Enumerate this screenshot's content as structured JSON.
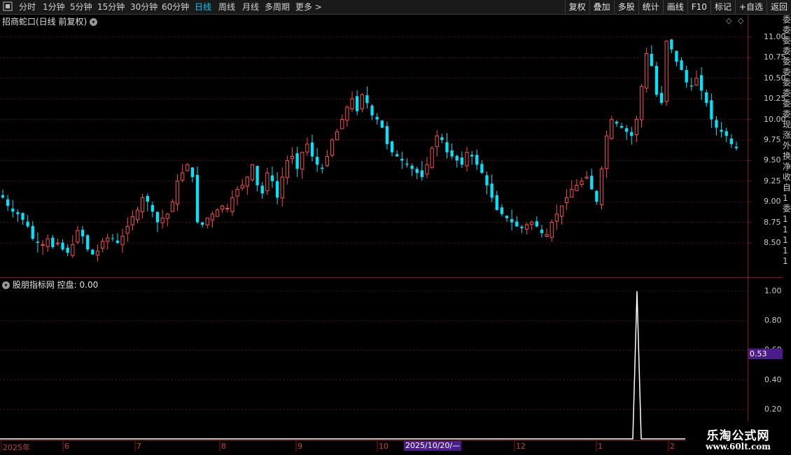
{
  "toolbar": {
    "periods": [
      "分时",
      "1分钟",
      "5分钟",
      "15分钟",
      "30分钟",
      "60分钟",
      "日线",
      "周线",
      "月线",
      "多周期",
      "更多 >"
    ],
    "active_period": "日线",
    "right_buttons": [
      "复权",
      "叠加",
      "多股",
      "统计",
      "画线",
      "F10",
      "标记",
      "+自选",
      "返回"
    ]
  },
  "main_panel": {
    "title": "招商蛇口(日线 前复权)",
    "price_ticks": [
      "11.00",
      "10.75",
      "10.50",
      "10.25",
      "10.00",
      "9.75",
      "9.50",
      "9.25",
      "9.00",
      "8.75",
      "8.50"
    ]
  },
  "indicator_panel": {
    "title": "股朋指标网 控盘: 0.00",
    "ticks": [
      "1.00",
      "0.80",
      "0.60",
      "0.40",
      "0.20"
    ],
    "crosshair_value": "0.53"
  },
  "date_axis": {
    "labels": [
      "2025年",
      "6",
      "7",
      "8",
      "9",
      "10",
      "12",
      "1",
      "2"
    ],
    "crosshair_date": "2025/10/20/—"
  },
  "right_strip_text": "委委委委委委委委委委现涨外换净收自1委11111",
  "watermark": {
    "title": "乐淘公式网",
    "url": "www.60lt.com"
  },
  "colors": {
    "up": "#ff4d4d",
    "down": "#00e5ff",
    "grid": "#8b1515",
    "accent": "#00c8ff",
    "badge": "#4b1d8c"
  },
  "chart_data": [
    {
      "type": "candlestick",
      "title": "招商蛇口(日线 前复权)",
      "y_ticks": [
        8.5,
        8.75,
        9.0,
        9.25,
        9.5,
        9.75,
        10.0,
        10.25,
        10.5,
        10.75,
        11.0
      ],
      "x_labels": [
        "2025年",
        "6",
        "7",
        "8",
        "9",
        "10",
        "12",
        "1",
        "2"
      ],
      "close_trend": [
        9.05,
        8.95,
        8.88,
        8.85,
        8.78,
        8.7,
        8.55,
        8.5,
        8.48,
        8.55,
        8.45,
        8.5,
        8.42,
        8.38,
        8.48,
        8.65,
        8.58,
        8.42,
        8.36,
        8.4,
        8.52,
        8.56,
        8.55,
        8.5,
        8.58,
        8.7,
        8.82,
        8.9,
        9.05,
        9.0,
        8.88,
        8.75,
        8.8,
        8.85,
        9.0,
        9.25,
        9.35,
        9.45,
        9.3,
        8.75,
        8.72,
        8.8,
        8.85,
        8.9,
        8.95,
        8.92,
        9.05,
        9.15,
        9.2,
        9.3,
        9.45,
        9.2,
        9.1,
        9.35,
        9.25,
        9.05,
        9.3,
        9.5,
        9.55,
        9.4,
        9.6,
        9.7,
        9.55,
        9.45,
        9.4,
        9.55,
        9.75,
        9.85,
        10.0,
        10.15,
        10.25,
        10.1,
        10.3,
        10.2,
        10.05,
        10.0,
        9.9,
        9.7,
        9.6,
        9.55,
        9.5,
        9.45,
        9.4,
        9.35,
        9.3,
        9.45,
        9.65,
        9.8,
        9.75,
        9.6,
        9.55,
        9.5,
        9.45,
        9.6,
        9.55,
        9.45,
        9.35,
        9.2,
        9.05,
        8.9,
        8.85,
        8.8,
        8.75,
        8.7,
        8.68,
        8.72,
        8.75,
        8.7,
        8.62,
        8.6,
        8.75,
        8.85,
        8.95,
        9.05,
        9.15,
        9.2,
        9.25,
        9.3,
        9.15,
        9.0,
        9.4,
        9.8,
        10.0,
        9.95,
        9.9,
        9.85,
        9.8,
        10.0,
        10.4,
        10.8,
        10.65,
        10.3,
        10.2,
        10.95,
        10.85,
        10.7,
        10.6,
        10.45,
        10.4,
        10.5,
        10.35,
        10.2,
        10.0,
        9.9,
        9.85,
        9.8,
        9.7,
        9.65
      ]
    },
    {
      "type": "line",
      "title": "股朋指标网 控盘: 0.00",
      "name": "控盘",
      "y_ticks": [
        0.2,
        0.4,
        0.6,
        0.8,
        1.0
      ],
      "values_note_free": true,
      "peak_value": 1.0,
      "peak_position": 0.806,
      "baseline": 0.0
    }
  ]
}
